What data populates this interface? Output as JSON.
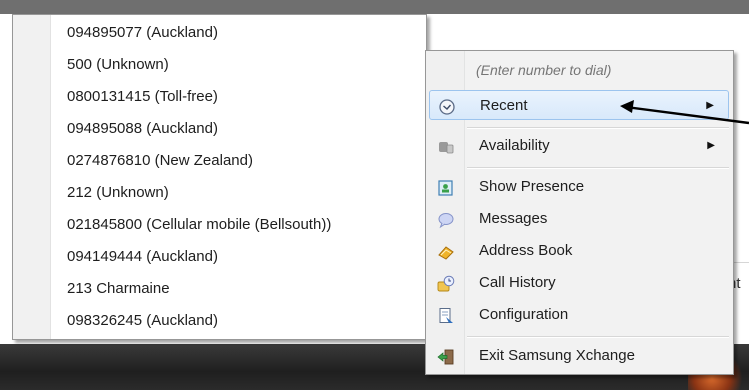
{
  "recent_numbers": [
    "094895077  (Auckland)",
    "500  (Unknown)",
    "0800131415  (Toll-free)",
    "094895088  (Auckland)",
    "0274876810  (New Zealand)",
    "212  (Unknown)",
    "021845800  (Cellular mobile (Bellsouth))",
    "094149444  (Auckland)",
    "213  Charmaine",
    "098326245  (Auckland)"
  ],
  "menu": {
    "dial_placeholder": "(Enter number to dial)",
    "recent": "Recent",
    "availability": "Availability",
    "show_presence": "Show Presence",
    "messages": "Messages",
    "address_book": "Address Book",
    "call_history": "Call History",
    "configuration": "Configuration",
    "exit": "Exit Samsung Xchange"
  },
  "background": {
    "edge_text": "nt"
  },
  "icons": {
    "recent": "clock-icon",
    "availability": "phone-handset-icon",
    "show_presence": "presence-card-icon",
    "messages": "speech-bubble-icon",
    "address_book": "address-book-icon",
    "call_history": "call-history-icon",
    "configuration": "configuration-icon",
    "exit": "exit-icon"
  },
  "colors": {
    "highlight": "#d8e9fb",
    "highlight_border": "#9cc4ee",
    "menu_bg": "#f2f2f2"
  }
}
